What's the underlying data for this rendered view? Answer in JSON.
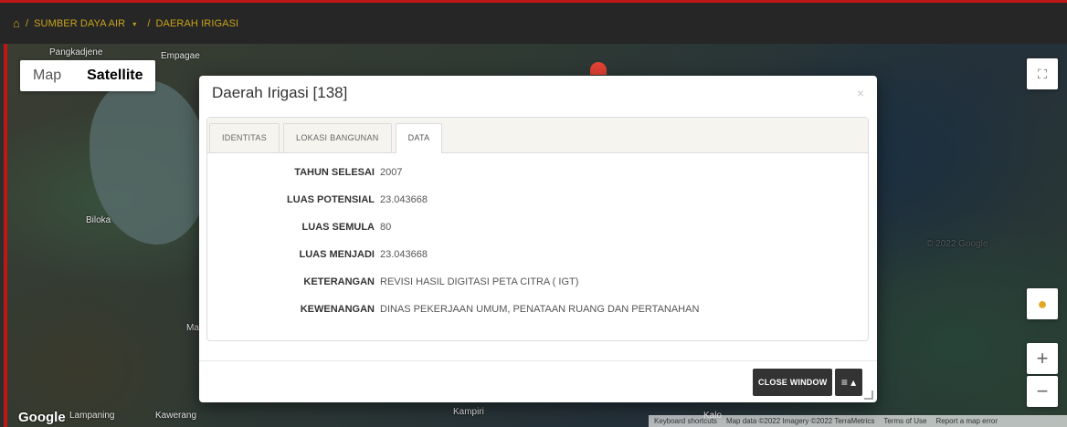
{
  "breadcrumb": {
    "home_icon": "home-icon",
    "separator": "/",
    "items": [
      "SUMBER DAYA AIR",
      "DAERAH IRIGASI"
    ],
    "dropdown_caret": "▾"
  },
  "map": {
    "type_buttons": [
      "Map",
      "Satellite"
    ],
    "active_type": "Satellite",
    "labels": [
      "Pangkadjene",
      "Empagae",
      "Biloka",
      "Mac",
      "Lampaning",
      "Kawerang",
      "Kampiri",
      "Kalo"
    ],
    "google_logo": "Google",
    "watermark": "© 2022 Google",
    "footer_links": [
      "Keyboard shortcuts",
      "Map data ©2022 Imagery ©2022 TerraMetrics",
      "Terms of Use",
      "Report a map error"
    ],
    "controls": {
      "fullscreen_icon": "fullscreen-icon",
      "pegman_icon": "pegman-icon",
      "zoom_in": "+",
      "zoom_out": "−"
    }
  },
  "modal": {
    "title": "Daerah Irigasi [138]",
    "close_symbol": "×",
    "tabs": [
      "IDENTITAS",
      "LOKASI BANGUNAN",
      "DATA"
    ],
    "active_tab": "DATA",
    "rows": [
      {
        "label": "TAHUN SELESAI",
        "value": "2007"
      },
      {
        "label": "LUAS POTENSIAL",
        "value": "23.043668"
      },
      {
        "label": "LUAS SEMULA",
        "value": "80"
      },
      {
        "label": "LUAS MENJADI",
        "value": "23.043668"
      },
      {
        "label": "KETERANGAN",
        "value": "REVISI HASIL DIGITASI PETA CITRA ( IGT)"
      },
      {
        "label": "KEWENANGAN",
        "value": "DINAS PEKERJAAN UMUM, PENATAAN RUANG DAN PERTANAHAN"
      }
    ],
    "close_window_label": "CLOSE WINDOW",
    "menu_label": "≡ ▴"
  }
}
